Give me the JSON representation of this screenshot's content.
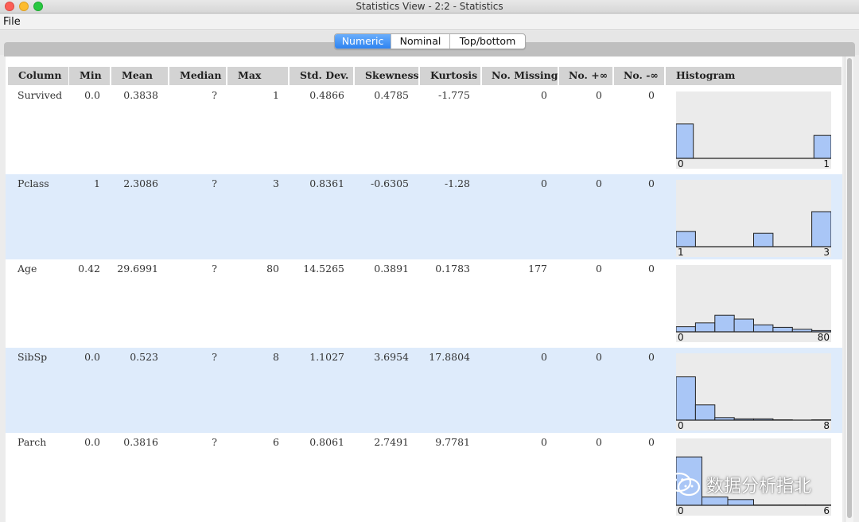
{
  "window": {
    "title": "Statistics View - 2:2 - Statistics"
  },
  "menu": {
    "file": "File"
  },
  "tabs": [
    {
      "label": "Numeric",
      "active": true
    },
    {
      "label": "Nominal",
      "active": false
    },
    {
      "label": "Top/bottom",
      "active": false
    }
  ],
  "columns": [
    "Column",
    "Min",
    "Mean",
    "Median",
    "Max",
    "Std. Dev.",
    "Skewness",
    "Kurtosis",
    "No. Missing",
    "No. +∞",
    "No. -∞",
    "Histogram"
  ],
  "rows": [
    {
      "column": "Survived",
      "min": "0.0",
      "mean": "0.3838",
      "median": "?",
      "max": "1",
      "std": "0.4866",
      "skew": "0.4785",
      "kurt": "-1.775",
      "missing": "0",
      "pinf": "0",
      "ninf": "0",
      "hist": {
        "min_label": "0",
        "max_label": "1",
        "bars": [
          0.54,
          0,
          0,
          0,
          0,
          0,
          0,
          0,
          0.36
        ]
      }
    },
    {
      "column": "Pclass",
      "min": "1",
      "mean": "2.3086",
      "median": "?",
      "max": "3",
      "std": "0.8361",
      "skew": "-0.6305",
      "kurt": "-1.28",
      "missing": "0",
      "pinf": "0",
      "ninf": "0",
      "hist": {
        "min_label": "1",
        "max_label": "3",
        "bars": [
          0.24,
          0,
          0,
          0,
          0.21,
          0,
          0,
          0.55
        ]
      }
    },
    {
      "column": "Age",
      "min": "0.42",
      "mean": "29.6991",
      "median": "?",
      "max": "80",
      "std": "14.5265",
      "skew": "0.3891",
      "kurt": "0.1783",
      "missing": "177",
      "pinf": "0",
      "ninf": "0",
      "hist": {
        "min_label": "0",
        "max_label": "80",
        "bars": [
          0.08,
          0.14,
          0.26,
          0.2,
          0.11,
          0.07,
          0.04,
          0.02
        ]
      }
    },
    {
      "column": "SibSp",
      "min": "0.0",
      "mean": "0.523",
      "median": "?",
      "max": "8",
      "std": "1.1027",
      "skew": "3.6954",
      "kurt": "17.8804",
      "missing": "0",
      "pinf": "0",
      "ninf": "0",
      "hist": {
        "min_label": "0",
        "max_label": "8",
        "bars": [
          0.68,
          0.24,
          0.04,
          0.02,
          0.02,
          0.005,
          0,
          0.005
        ]
      }
    },
    {
      "column": "Parch",
      "min": "0.0",
      "mean": "0.3816",
      "median": "?",
      "max": "6",
      "std": "0.8061",
      "skew": "2.7491",
      "kurt": "9.7781",
      "missing": "0",
      "pinf": "0",
      "ninf": "0",
      "hist": {
        "min_label": "0",
        "max_label": "6",
        "bars": [
          0.76,
          0.13,
          0.09,
          0.005,
          0.005,
          0.005
        ]
      }
    }
  ],
  "colors": {
    "accent": "#2e83f0",
    "alt_row": "#deebfb",
    "header_bg": "#d3d3d3",
    "hist_bar": "#a9c6f6",
    "hist_bg": "#ebebeb"
  },
  "watermark": {
    "icon": "wechat-icon",
    "text": "数据分析指北"
  }
}
